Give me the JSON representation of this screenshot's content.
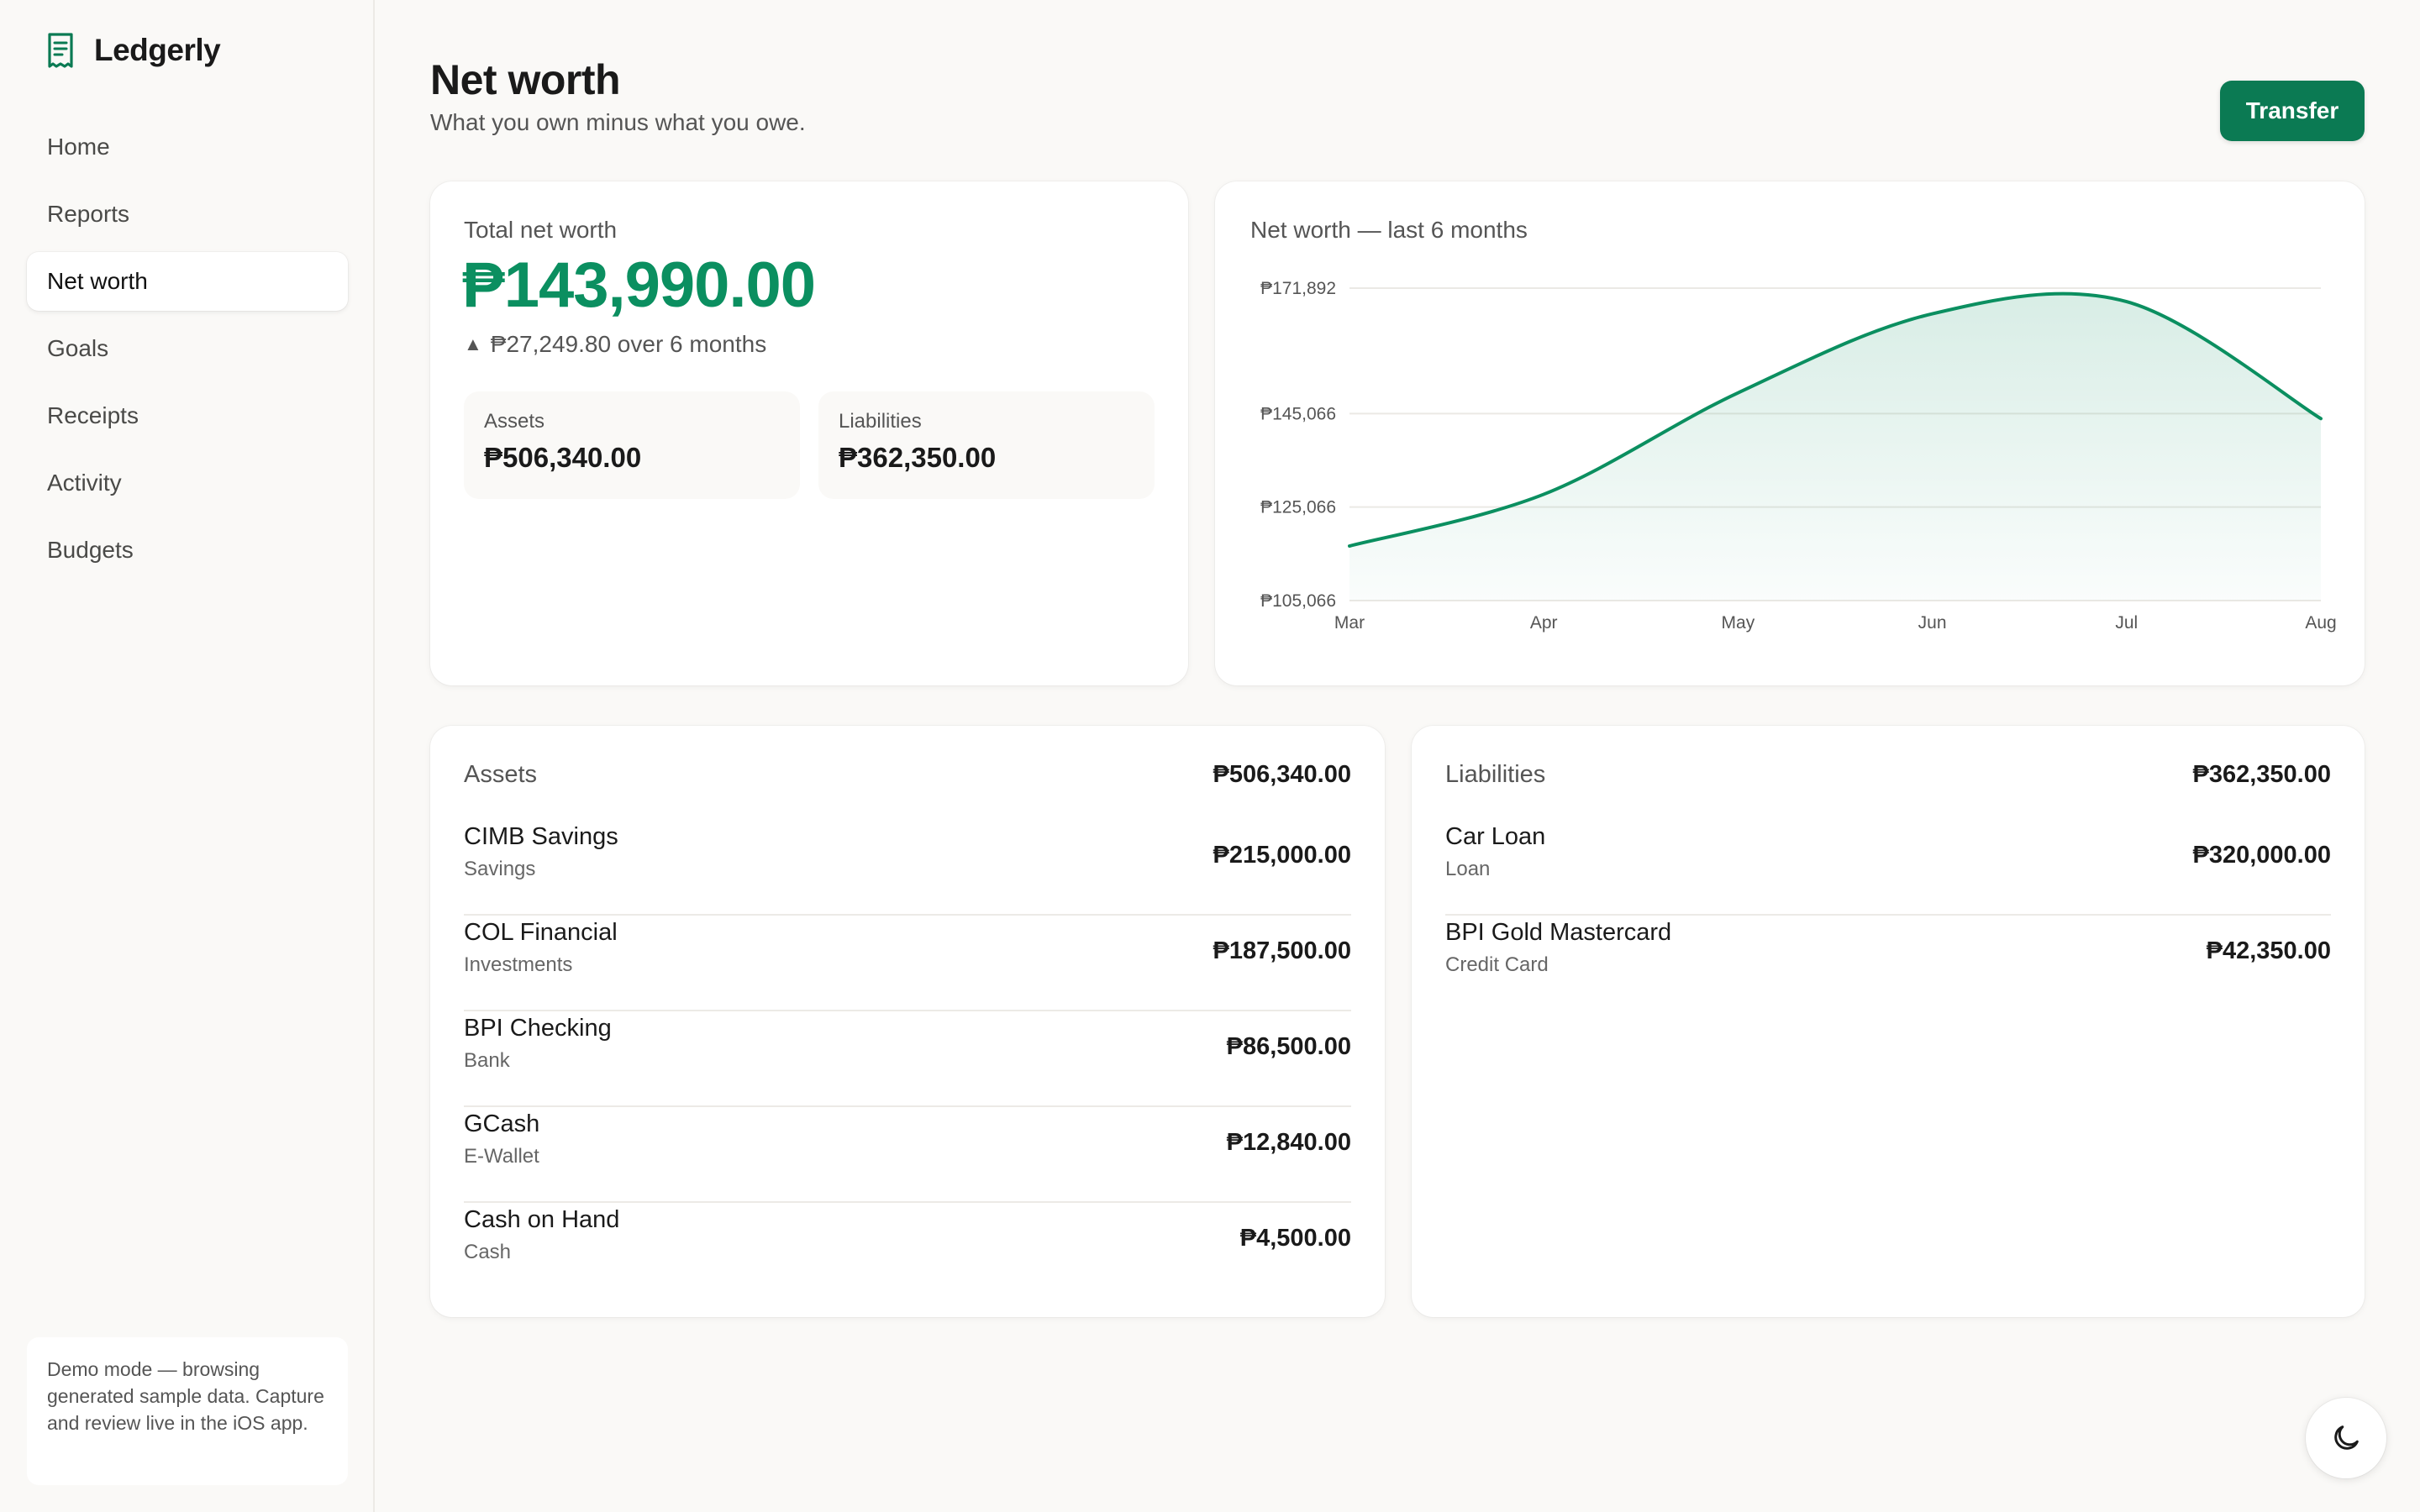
{
  "app": {
    "name": "Ledgerly"
  },
  "nav": [
    {
      "label": "Home",
      "active": false
    },
    {
      "label": "Reports",
      "active": false
    },
    {
      "label": "Net worth",
      "active": true
    },
    {
      "label": "Goals",
      "active": false
    },
    {
      "label": "Receipts",
      "active": false
    },
    {
      "label": "Activity",
      "active": false
    },
    {
      "label": "Budgets",
      "active": false
    }
  ],
  "demo_notice": "Demo mode — browsing generated sample data. Capture and review live in the iOS app.",
  "header": {
    "title": "Net worth",
    "subtitle": "What you own minus what you owe.",
    "transfer_label": "Transfer"
  },
  "summary": {
    "label": "Total net worth",
    "total": "₱143,990.00",
    "change_icon": "triangle-up-icon",
    "change": "₱27,249.80 over 6 months",
    "assets_label": "Assets",
    "assets_value": "₱506,340.00",
    "liabilities_label": "Liabilities",
    "liabilities_value": "₱362,350.00"
  },
  "chart_data": {
    "type": "area",
    "title": "Net worth — last 6 months",
    "categories": [
      "Mar",
      "Apr",
      "May",
      "Jun",
      "Jul",
      "Aug"
    ],
    "series": [
      {
        "values": [
          116740,
          127800,
          149500,
          166400,
          169000,
          143990
        ]
      }
    ],
    "y_ticks": [
      "₱171,892",
      "₱145,066",
      "₱125,066",
      "₱105,066"
    ],
    "y_tick_values": [
      171892,
      145066,
      125066,
      105066
    ],
    "ylim": [
      105066,
      171892
    ],
    "grid": true,
    "legend": false,
    "color": "#0b8f60"
  },
  "assets": {
    "heading": "Assets",
    "total": "₱506,340.00",
    "items": [
      {
        "name": "CIMB Savings",
        "type": "Savings",
        "amount": "₱215,000.00"
      },
      {
        "name": "COL Financial",
        "type": "Investments",
        "amount": "₱187,500.00"
      },
      {
        "name": "BPI Checking",
        "type": "Bank",
        "amount": "₱86,500.00"
      },
      {
        "name": "GCash",
        "type": "E-Wallet",
        "amount": "₱12,840.00"
      },
      {
        "name": "Cash on Hand",
        "type": "Cash",
        "amount": "₱4,500.00"
      }
    ]
  },
  "liabilities": {
    "heading": "Liabilities",
    "total": "₱362,350.00",
    "items": [
      {
        "name": "Car Loan",
        "type": "Loan",
        "amount": "₱320,000.00"
      },
      {
        "name": "BPI Gold Mastercard",
        "type": "Credit Card",
        "amount": "₱42,350.00"
      }
    ]
  },
  "theme_toggle_icon": "moon-icon",
  "colors": {
    "accent": "#0b7a53",
    "positive": "#0b8f60",
    "background": "#faf9f7"
  }
}
